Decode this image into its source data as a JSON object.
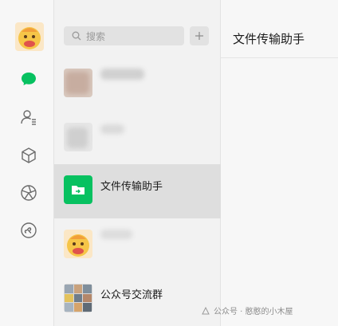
{
  "search": {
    "placeholder": "搜索"
  },
  "chat_header": {
    "title": "文件传输助手"
  },
  "sessions": [
    {
      "name": "",
      "blurred": true
    },
    {
      "name": "",
      "blurred": true
    },
    {
      "name": "文件传输助手",
      "active": true
    },
    {
      "name": "",
      "blurred": true
    },
    {
      "name": "公众号交流群"
    }
  ],
  "watermark": {
    "text": "公众号 · 憨憨的小木屋"
  },
  "icons": {
    "rail": [
      "avatar",
      "chat-icon",
      "contacts-icon",
      "favorites-cube-icon",
      "moments-shutter-icon",
      "mini-programs-icon"
    ],
    "list": [
      "search-icon",
      "plus-icon"
    ]
  },
  "colors": {
    "accent": "#07c160",
    "active_row": "#dedede",
    "rail_bg": "#f7f7f7",
    "list_bg": "#f2f2f2"
  }
}
